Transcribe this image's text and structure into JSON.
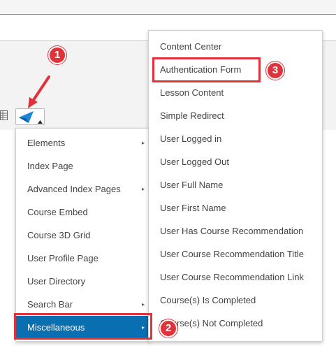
{
  "toolbar": {
    "grid_icon": "table-icon",
    "plugin_icon": "plugin-arrow-icon",
    "caret_icon": "caret-up-icon"
  },
  "main_menu": {
    "items": [
      {
        "label": "Elements",
        "has_submenu": true
      },
      {
        "label": "Index Page",
        "has_submenu": false
      },
      {
        "label": "Advanced Index Pages",
        "has_submenu": true
      },
      {
        "label": "Course Embed",
        "has_submenu": false
      },
      {
        "label": "Course 3D Grid",
        "has_submenu": false
      },
      {
        "label": "User Profile Page",
        "has_submenu": false
      },
      {
        "label": "User Directory",
        "has_submenu": false
      },
      {
        "label": "Search Bar",
        "has_submenu": true
      },
      {
        "label": "Miscellaneous",
        "has_submenu": true,
        "active": true
      }
    ]
  },
  "sub_menu": {
    "items": [
      {
        "label": "Content Center"
      },
      {
        "label": "Authentication Form"
      },
      {
        "label": "Lesson Content"
      },
      {
        "label": "Simple Redirect"
      },
      {
        "label": "User Logged in"
      },
      {
        "label": "User Logged Out"
      },
      {
        "label": "User Full Name"
      },
      {
        "label": "User First Name"
      },
      {
        "label": "User Has Course Recommendation"
      },
      {
        "label": "User Course Recommendation Title"
      },
      {
        "label": "User Course Recommendation Link"
      },
      {
        "label": "Course(s) Is Completed"
      },
      {
        "label": "Course(s) Not Completed"
      }
    ]
  },
  "annotations": {
    "badge_1": "1",
    "badge_2": "2",
    "badge_3": "3",
    "accent_color": "#e0323a",
    "active_color": "#0a6fb0"
  },
  "icons": {
    "submenu_arrow": "▸"
  }
}
